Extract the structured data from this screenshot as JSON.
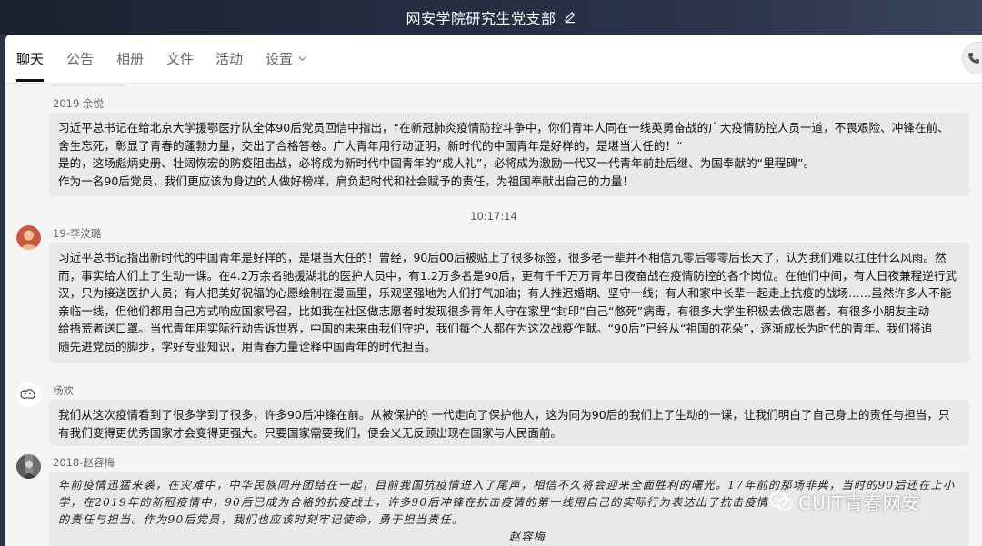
{
  "window": {
    "title": "网安学院研究生党支部"
  },
  "tabs": [
    {
      "label": "聊天",
      "active": true
    },
    {
      "label": "公告"
    },
    {
      "label": "相册"
    },
    {
      "label": "文件"
    },
    {
      "label": "活动"
    },
    {
      "label": "设置"
    }
  ],
  "messages": [
    {
      "sender": "2019 余悦",
      "lines": [
        "习近平总书记在给北京大学援鄂医疗队全体90后党员回信中指出，“在新冠肺炎疫情防控斗争中，你们青年人同在一线英勇奋战的广大疫情防控人员一道，不畏艰险、冲锋在前、",
        "舍生忘死，彰显了青春的蓬勃力量，交出了合格答卷。广大青年用行动证明，新时代的中国青年是好样的，是堪当大任的！“",
        "是的，这场彪炳史册、壮阔恢宏的防疫阻击战，必将成为新时代中国青年的“成人礼”，必将成为激励一代又一代青年前赴后继、为国奉献的“里程碑”。",
        "作为一名90后党员，我们更应该为身边的人做好榜样，肩负起时代和社会赋予的责任，为祖国奉献出自己的力量！"
      ]
    },
    {
      "sender": "19-李汶璐",
      "lines": [
        "习近平总书记指出新时代的中国青年是好样的，是堪当大任的！曾经，90后00后被贴上了很多标签，很多老一辈并不相信九零后零零后长大了，认为我们难以扛住什么风雨。然",
        "而，事实给人们上了生动一课。在4.2万余名驰援湖北的医护人员中，有1.2万多名是90后，更有千千万万青年日夜奋战在疫情防控的各个岗位。在他们中间，有人日夜兼程逆行武",
        "汉，只为接送医护人员；有人把美好祝福的心愿绘制在漫画里，乐观坚强地为人们打气加油；有人推迟婚期、坚守一线；有人和家中长辈一起走上抗疫的战场……虽然许多人不能",
        "亲临一线，但他们都用自己方式响应国家号召，比如我在社区做志愿者时发现很多青年人守在家里“封印”自己“憋死”病毒，有很多大学生积极去做志愿者，有很多小朋友主动",
        "给捂荒者送口罩。当代青年用实际行动告诉世界，中国的未来由我们守护，我们每个人都在为这次战疫作献。“90后”已经从“祖国的花朵”，逐渐成长为时代的青年。我们将追",
        "随先进党员的脚步，学好专业知识，用青春力量诠释中国青年的时代担当。"
      ]
    },
    {
      "sender": "杨欢",
      "lines": [
        "我们从这次疫情看到了很多学到了很多，许多90后冲锋在前。从被保护的 一代走向了保护他人，这为同为90后的我们上了生动的一课，让我们明白了自己身上的责任与担当，只",
        "有我们变得更优秀国家才会变得更强大。只要国家需要我们，便会义无反顾出现在国家与人民面前。"
      ]
    },
    {
      "sender": "2018-赵容梅",
      "lines": [
        "年前疫情迅猛来袭，在灾难中，中华民族同舟团结在一起，目前我国抗疫情进入了尾声，相信不久将会迎来全面胜利的曙光。17年前的那场非典，当时的90后还在上小",
        "学，在2019年的新冠疫情中，90后已成为合格的抗疫战士，许多90后冲锋在抗击疫情的第一线用自己的实际行为表达出了抗击疫情",
        "的责任与担当。作为90后党员，我们也应该时刻牢记使命，勇于担当责任。"
      ],
      "signature": "赵容梅"
    }
  ],
  "timestamp": "10:17:14",
  "watermark": "CUIT青春网安",
  "colors": {
    "titlebar": "#1d2537",
    "panel_bg": "#f5f5f5",
    "bubble_bg": "#e9e9e9",
    "text": "#111111"
  }
}
